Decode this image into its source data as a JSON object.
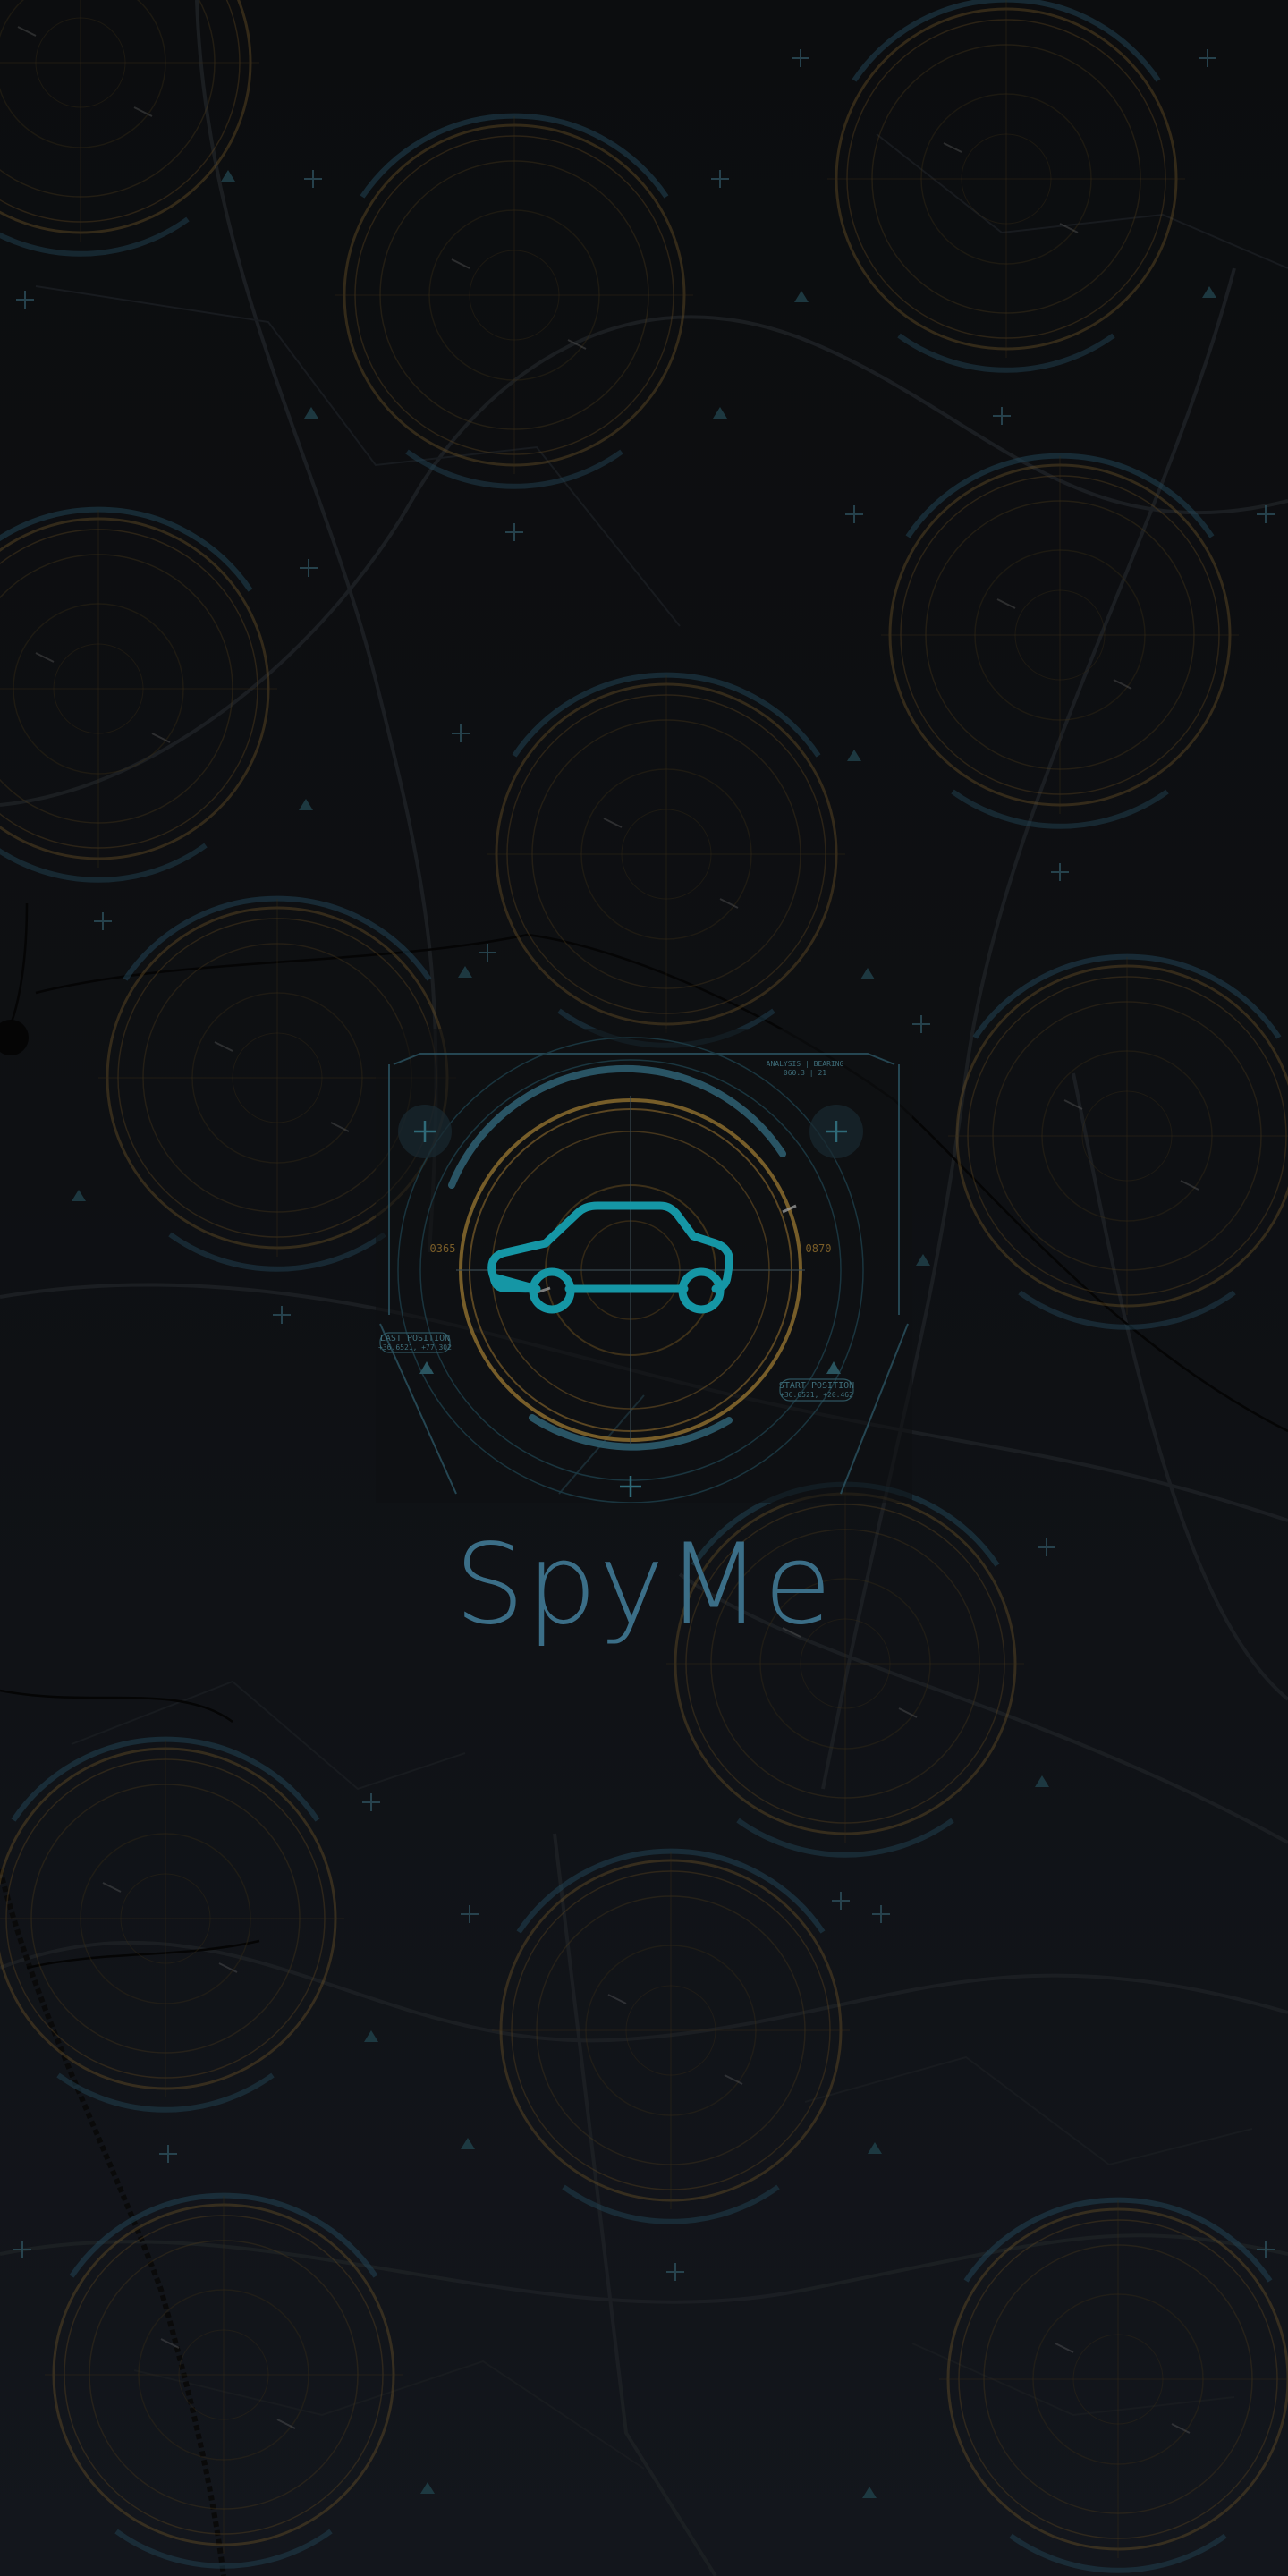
{
  "app": {
    "name": "SpyMe"
  },
  "logo": {
    "icon": "car-icon",
    "hud_labels": {
      "last_position": "LAST POSITION",
      "last_coords": "+36.6521, +77.302",
      "start_position": "START POSITION",
      "start_coords": "+36.6521, +20.462",
      "bearing_left": "0365",
      "bearing_right": "0870",
      "top_right_line1": "ANALYSIS | BEARING",
      "top_right_line2": "060.3 | 21"
    }
  },
  "colors": {
    "accent": "#1596a5",
    "title": "#3b6e87",
    "ring_amber": "#8a6b2e",
    "ring_blue": "#2e5d6e",
    "background": "#0d0e10"
  }
}
